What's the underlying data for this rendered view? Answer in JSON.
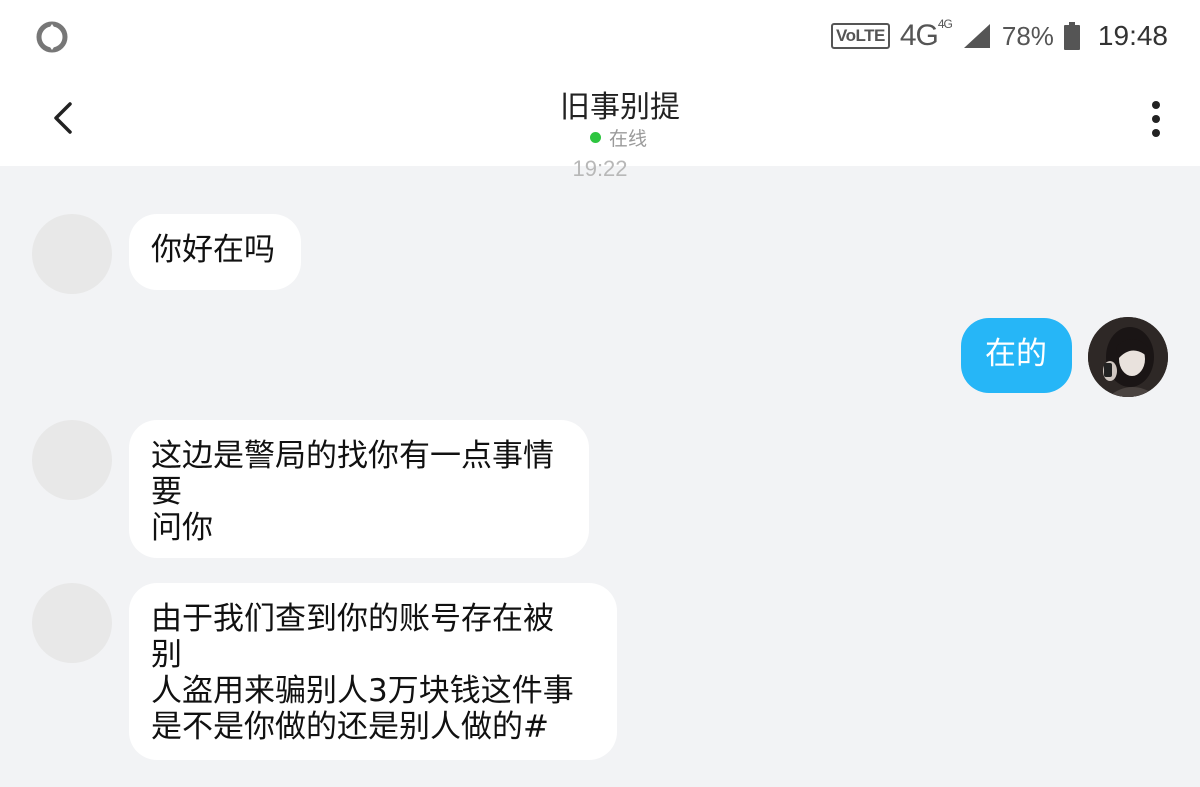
{
  "status_bar": {
    "volte": "VoLTE",
    "network": "4G",
    "network_small": "4G",
    "battery_percent": "78%",
    "time": "19:48"
  },
  "header": {
    "contact_name": "旧事别提",
    "presence": "在线"
  },
  "chat": {
    "timestamp": "19:22",
    "messages": [
      {
        "direction": "incoming",
        "text": "你好在吗"
      },
      {
        "direction": "outgoing",
        "text": "在的"
      },
      {
        "direction": "incoming",
        "text": "这边是警局的找你有一点事情\n要\n问你"
      },
      {
        "direction": "incoming",
        "text": "由于我们查到你的账号存在被\n别\n人盗用来骗别人3万块钱这件事\n是不是你做的还是别人做的#"
      }
    ]
  },
  "colors": {
    "outgoing_bubble": "#26b6f7",
    "incoming_bubble": "#ffffff",
    "background": "#f2f3f5",
    "online_dot": "#2dc53f"
  },
  "icons": {
    "back": "chevron-left-icon",
    "more": "more-vertical-icon",
    "app": "app-logo-icon",
    "signal": "signal-icon",
    "battery": "battery-icon"
  }
}
